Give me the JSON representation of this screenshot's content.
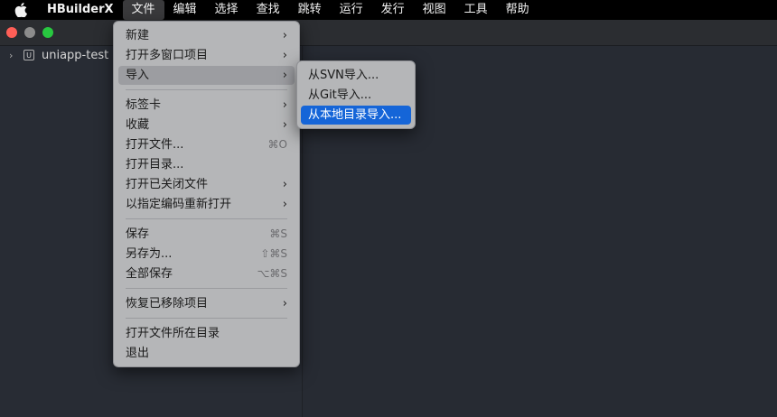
{
  "menubar": {
    "app_name": "HBuilderX",
    "items": [
      "文件",
      "编辑",
      "选择",
      "查找",
      "跳转",
      "运行",
      "发行",
      "视图",
      "工具",
      "帮助"
    ]
  },
  "colors": {
    "highlight": "#1565d8",
    "close": "#ff5f57",
    "zoom": "#28c840"
  },
  "sidebar": {
    "project_name": "uniapp-test",
    "project_icon_glyph": "U"
  },
  "file_menu": {
    "new": "新建",
    "open_multi_window_project": "打开多窗口项目",
    "import": "导入",
    "tabs": "标签卡",
    "favorites": "收藏",
    "open_file": "打开文件...",
    "open_file_shortcut": "⌘O",
    "open_directory": "打开目录...",
    "open_closed_file": "打开已关闭文件",
    "reopen_with_encoding": "以指定编码重新打开",
    "save": "保存",
    "save_shortcut": "⌘S",
    "save_as": "另存为...",
    "save_as_shortcut": "⇧⌘S",
    "save_all": "全部保存",
    "save_all_shortcut": "⌥⌘S",
    "restore_removed_project": "恢复已移除项目",
    "open_containing_directory": "打开文件所在目录",
    "exit": "退出"
  },
  "import_menu": {
    "from_svn": "从SVN导入...",
    "from_git": "从Git导入...",
    "from_local_dir": "从本地目录导入..."
  }
}
